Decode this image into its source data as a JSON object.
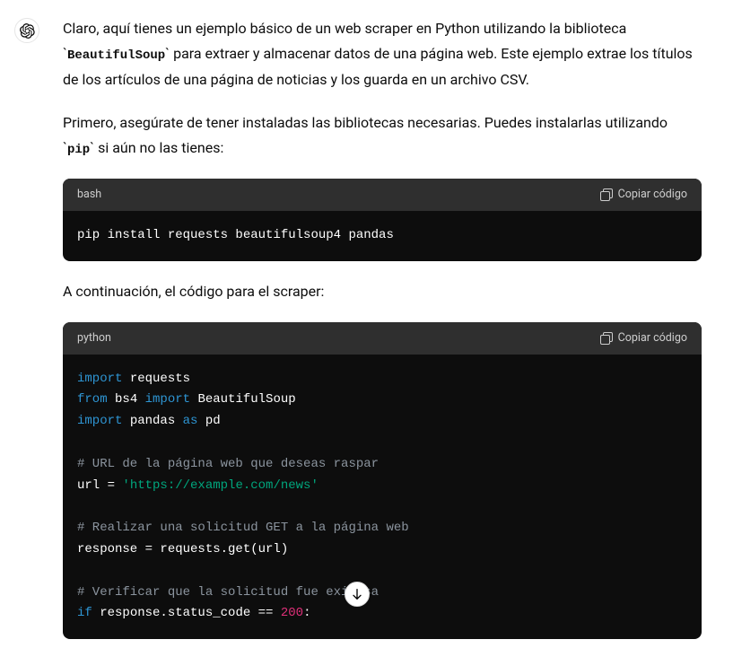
{
  "intro": {
    "part1": "Claro, aquí tienes un ejemplo básico de un web scraper en Python utilizando la biblioteca `",
    "code1": "BeautifulSoup",
    "part2": "` para extraer y almacenar datos de una página web. Este ejemplo extrae los títulos de los artículos de una página de noticias y los guarda en un archivo CSV."
  },
  "install": {
    "part1": "Primero, asegúrate de tener instaladas las bibliotecas necesarias. Puedes instalarlas utilizando `",
    "code1": "pip",
    "part2": "` si aún no las tienes:"
  },
  "bash_block": {
    "lang": "bash",
    "copy_label": "Copiar código",
    "code": "pip install requests beautifulsoup4 pandas"
  },
  "continuation": "A continuación, el código para el scraper:",
  "python_block": {
    "lang": "python",
    "copy_label": "Copiar código",
    "tokens": {
      "l1_kw": "import",
      "l1_rest": " requests",
      "l2_kw1": "from",
      "l2_mid": " bs4 ",
      "l2_kw2": "import",
      "l2_rest": " BeautifulSoup",
      "l3_kw1": "import",
      "l3_mid": " pandas ",
      "l3_kw2": "as",
      "l3_rest": " pd",
      "l5_comment": "# URL de la página web que deseas raspar",
      "l6_pre": "url = ",
      "l6_str": "'https://example.com/news'",
      "l8_comment": "# Realizar una solicitud GET a la página web",
      "l9": "response = requests.get(url)",
      "l11_comment": "# Verificar que la solicitud fue exitosa",
      "l12_kw": "if",
      "l12_mid": " response.status_code == ",
      "l12_num": "200",
      "l12_end": ":"
    }
  }
}
